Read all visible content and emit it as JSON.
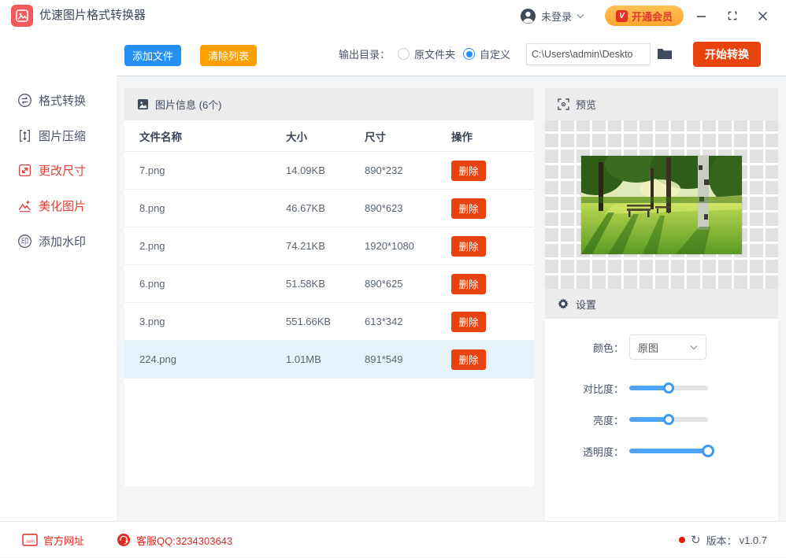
{
  "titlebar": {
    "app_title": "优速图片格式转换器",
    "login_label": "未登录",
    "vip_label": "开通会员",
    "vip_icon_letter": "V"
  },
  "toolbar": {
    "add_files": "添加文件",
    "clear_list": "清除列表",
    "output_dir_label": "输出目录：",
    "radio_original": "原文件夹",
    "radio_custom": "自定义",
    "path_value": "C:\\Users\\admin\\Deskto",
    "start_convert": "开始转换"
  },
  "sidebar": {
    "items": [
      {
        "label": "格式转换",
        "active": false
      },
      {
        "label": "图片压缩",
        "active": false
      },
      {
        "label": "更改尺寸",
        "active": true
      },
      {
        "label": "美化图片",
        "active": true
      },
      {
        "label": "添加水印",
        "active": false
      }
    ]
  },
  "file_panel": {
    "section_title": "图片信息 (6个)",
    "columns": [
      "文件名称",
      "大小",
      "尺寸",
      "操作"
    ],
    "delete_label": "删除",
    "rows": [
      {
        "name": "7.png",
        "size": "14.09KB",
        "dims": "890*232",
        "selected": false
      },
      {
        "name": "8.png",
        "size": "46.67KB",
        "dims": "890*623",
        "selected": false
      },
      {
        "name": "2.png",
        "size": "74.21KB",
        "dims": "1920*1080",
        "selected": false
      },
      {
        "name": "6.png",
        "size": "51.58KB",
        "dims": "890*625",
        "selected": false
      },
      {
        "name": "3.png",
        "size": "551.66KB",
        "dims": "613*342",
        "selected": false
      },
      {
        "name": "224.png",
        "size": "1.01MB",
        "dims": "891*549",
        "selected": true
      }
    ]
  },
  "preview": {
    "title": "预览"
  },
  "settings": {
    "title": "设置",
    "color_label": "颜色：",
    "color_value": "原图",
    "sliders": [
      {
        "label": "对比度：",
        "value": 50
      },
      {
        "label": "亮度：",
        "value": 50
      },
      {
        "label": "透明度：",
        "value": 100
      }
    ]
  },
  "footer": {
    "website": "官方网址",
    "qq": "客服QQ:3234303643",
    "version_label": "版本：",
    "version": "v1.0.7"
  },
  "colors": {
    "brand_red": "#f25b5b",
    "accent_blue": "#2590f2",
    "accent_orange": "#ffa000",
    "action_red": "#e8430e",
    "vip_gold": "#ffb43c",
    "footer_red": "#e02a20",
    "selected_row": "#e7f3fb",
    "slider_blue": "#4da3f5"
  }
}
